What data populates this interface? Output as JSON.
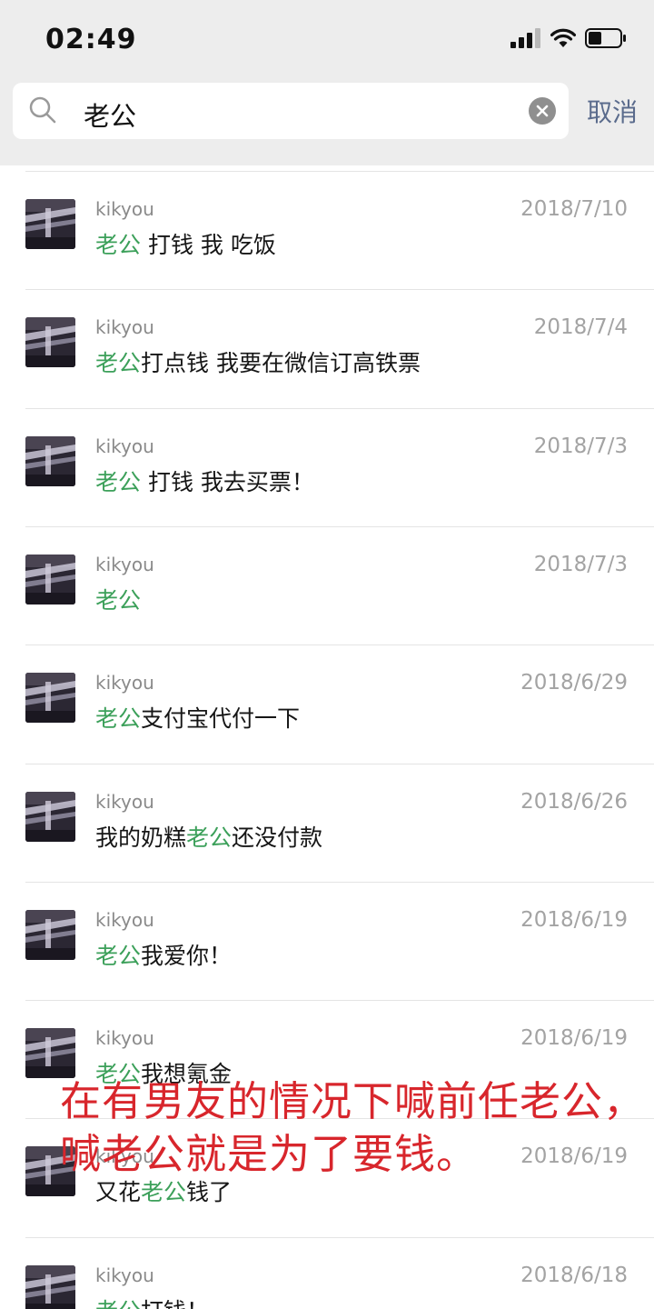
{
  "status_bar": {
    "time": "02:49"
  },
  "search": {
    "query": "老公",
    "cancel_label": "取消"
  },
  "results": [
    {
      "sender": "kikyou",
      "date": "2018/7/10",
      "parts": [
        {
          "t": "老公",
          "h": true
        },
        {
          "t": " 打钱 我 吃饭",
          "h": false
        }
      ]
    },
    {
      "sender": "kikyou",
      "date": "2018/7/4",
      "parts": [
        {
          "t": "老公",
          "h": true
        },
        {
          "t": "打点钱 我要在微信订高铁票",
          "h": false
        }
      ]
    },
    {
      "sender": "kikyou",
      "date": "2018/7/3",
      "parts": [
        {
          "t": "老公",
          "h": true
        },
        {
          "t": " 打钱 我去买票！",
          "h": false
        }
      ]
    },
    {
      "sender": "kikyou",
      "date": "2018/7/3",
      "parts": [
        {
          "t": "老公",
          "h": true
        }
      ]
    },
    {
      "sender": "kikyou",
      "date": "2018/6/29",
      "parts": [
        {
          "t": "老公",
          "h": true
        },
        {
          "t": "支付宝代付一下",
          "h": false
        }
      ]
    },
    {
      "sender": "kikyou",
      "date": "2018/6/26",
      "parts": [
        {
          "t": "我的奶糕",
          "h": false
        },
        {
          "t": "老公",
          "h": true
        },
        {
          "t": "还没付款",
          "h": false
        }
      ]
    },
    {
      "sender": "kikyou",
      "date": "2018/6/19",
      "parts": [
        {
          "t": "老公",
          "h": true
        },
        {
          "t": "我爱你！",
          "h": false
        }
      ]
    },
    {
      "sender": "kikyou",
      "date": "2018/6/19",
      "parts": [
        {
          "t": "老公",
          "h": true
        },
        {
          "t": "我想氪金",
          "h": false
        }
      ]
    },
    {
      "sender": "kikyou",
      "date": "2018/6/19",
      "parts": [
        {
          "t": "又花",
          "h": false
        },
        {
          "t": "老公",
          "h": true
        },
        {
          "t": "钱了",
          "h": false
        }
      ]
    },
    {
      "sender": "kikyou",
      "date": "2018/6/18",
      "parts": [
        {
          "t": "老公",
          "h": true
        },
        {
          "t": "打钱！",
          "h": false
        }
      ]
    }
  ],
  "overlay_caption": "在有男友的情况下喊前任老公，喊老公就是为了要钱。",
  "colors": {
    "highlight": "#3ca05a",
    "caption": "#d8262c",
    "cancel": "#5a6b8c"
  }
}
